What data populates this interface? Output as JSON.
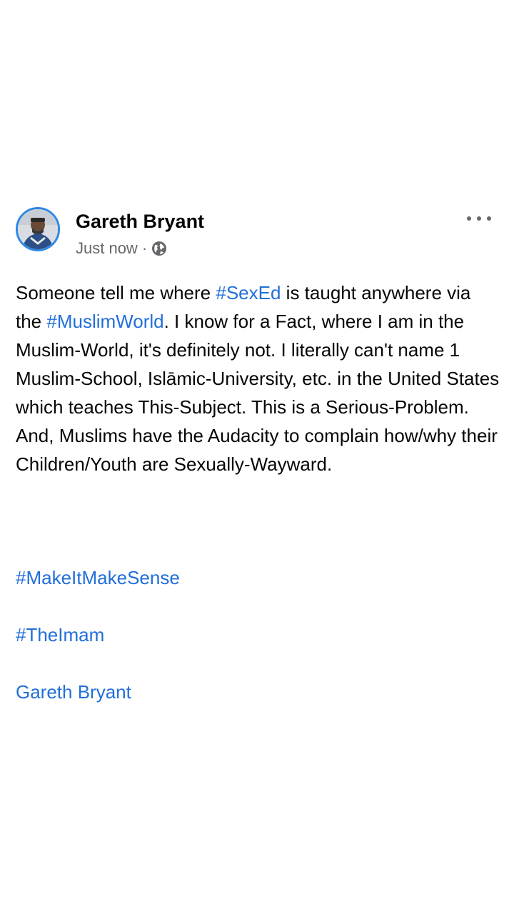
{
  "post": {
    "author": "Gareth Bryant",
    "timestamp": "Just now",
    "separator": "·",
    "privacy_icon": "globe-icon",
    "menu_icon": "more-options-icon",
    "body": {
      "t1": "Someone tell me where ",
      "h1": "#SexEd",
      "t2": " is taught anywhere via the ",
      "h2": "#MuslimWorld",
      "t3": ". I know for a Fact, where I am in the Muslim-World, it's definitely not. I literally can't name 1 Muslim-School, Islāmic-University, etc. in the United States which teaches This-Subject. This is a Serious-Problem. And, Muslims have the Audacity to complain how/why their Children/Youth are Sexually-Wayward."
    },
    "tags": [
      "#MakeItMakeSense",
      "#TheImam"
    ],
    "signature": "Gareth Bryant"
  },
  "colors": {
    "link": "#216fdb",
    "text": "#050505",
    "meta": "#65676b",
    "avatar_ring": "#2d88e5"
  }
}
